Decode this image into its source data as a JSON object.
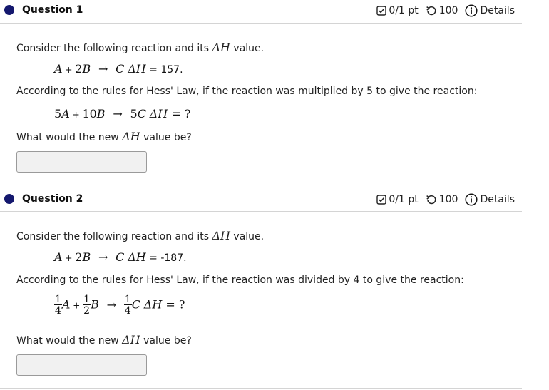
{
  "questions": [
    {
      "title": "Question 1",
      "score": "0/1 pt",
      "tries": "100",
      "details_label": "Details",
      "intro_before": "Consider the following reaction and its ",
      "intro_after": " value.",
      "delta_h": "ΔH",
      "eq_value": " = 157.",
      "rule_text": "According to the rules for Hess' Law, if the reaction was multiplied by 5 to give the reaction:",
      "question_before": "What would the new ",
      "question_after": " value be?",
      "answer_value": ""
    },
    {
      "title": "Question 2",
      "score": "0/1 pt",
      "tries": "100",
      "details_label": "Details",
      "intro_before": "Consider the following reaction and its ",
      "intro_after": " value.",
      "delta_h": "ΔH",
      "eq_value": " = -187.",
      "rule_text": "According to the rules for Hess' Law, if the reaction was divided by 4 to give the reaction:",
      "question_before": "What would the new ",
      "question_after": " value be?",
      "answer_value": ""
    }
  ],
  "icons": {
    "score": "check-square-icon",
    "tries": "retry-icon",
    "details": "info-circle-icon"
  },
  "colors": {
    "dot": "#14186e"
  }
}
